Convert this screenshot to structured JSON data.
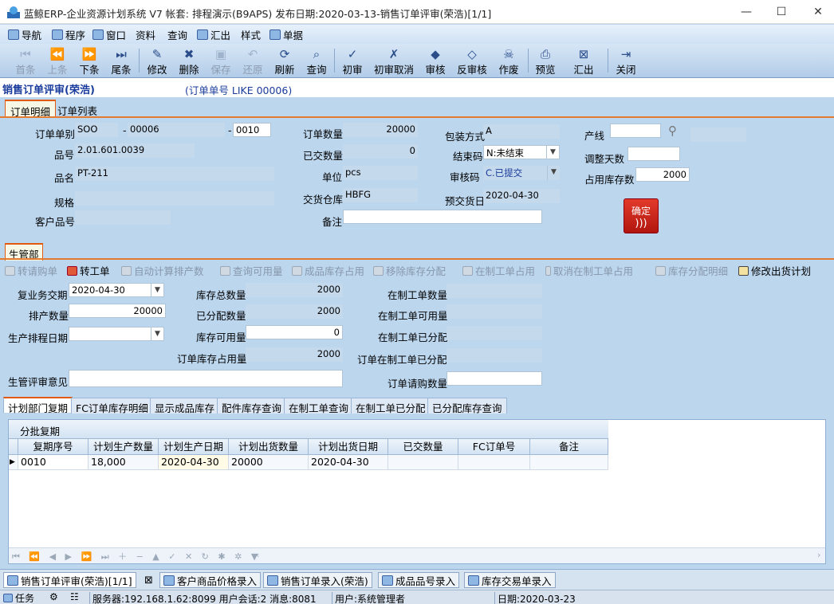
{
  "window": {
    "title": "蓝鲸ERP-企业资源计划系统 V7 帐套: 排程演示(B9APS) 发布日期:2020-03-13-销售订单评审(荣浩)[1/1]",
    "min": "—",
    "max": "☐",
    "close": "✕"
  },
  "menu": [
    "导航",
    "程序",
    "窗口",
    "资料",
    "查询",
    "汇出",
    "样式",
    "单据"
  ],
  "toolbar": [
    "首条",
    "上条",
    "下条",
    "尾条",
    "修改",
    "删除",
    "保存",
    "还原",
    "刷新",
    "查询",
    "初审",
    "初审取消",
    "审核",
    "反审核",
    "作废",
    "预览",
    "汇出",
    "关闭"
  ],
  "header": {
    "title": "销售订单评审(荣浩)",
    "filter": "(订单单号 LIKE 00006)"
  },
  "tabs": [
    "订单明细",
    "订单列表"
  ],
  "order": {
    "type_label": "订单单别",
    "type_value": "SOO",
    "no_value": "00006",
    "line_value": "0010",
    "item_label": "品号",
    "item_value": "2.01.601.0039",
    "name_label": "品名",
    "name_value": "PT-211",
    "spec_label": "规格",
    "spec_value": "",
    "cust_item_label": "客户品号",
    "cust_item_value": "",
    "qty_label": "订单数量",
    "qty_value": "20000",
    "delivered_label": "已交数量",
    "delivered_value": "0",
    "unit_label": "单位",
    "unit_value": "pcs",
    "warehouse_label": "交货仓库",
    "warehouse_value": "HBFG",
    "remark_label": "备注",
    "remark_value": "",
    "pack_label": "包装方式",
    "pack_value": "A",
    "close_label": "结束码",
    "close_value": "N:未结束",
    "audit_label": "审核码",
    "audit_value": "C.已提交",
    "eta_label": "预交货日",
    "eta_value": "2020-04-30",
    "line_label": "产线",
    "line_field": "",
    "adjust_label": "调整天数",
    "adjust_value": "",
    "stock_used_label": "占用库存数",
    "stock_used_value": "2000",
    "confirm": "确定"
  },
  "section_tab": "生管部",
  "tb2": [
    "转请购单",
    "转工单",
    "自动计算排产数",
    "查询可用量",
    "成品库存占用",
    "移除库存分配",
    "在制工单占用",
    "取消在制工单占用",
    "库存分配明细",
    "修改出货计划"
  ],
  "prod": {
    "reply_date_label": "复业务交期",
    "reply_date_value": "2020-04-30",
    "sched_qty_label": "排产数量",
    "sched_qty_value": "20000",
    "sched_date_label": "生产排程日期",
    "sched_date_value": "",
    "opinion_label": "生管评审意见",
    "opinion_value": "",
    "stock_total_label": "库存总数量",
    "stock_total_value": "2000",
    "allocated_label": "已分配数量",
    "allocated_value": "2000",
    "available_label": "库存可用量",
    "available_value": "0",
    "order_stock_label": "订单库存占用量",
    "order_stock_value": "2000",
    "wip_qty_label": "在制工单数量",
    "wip_qty_value": "",
    "wip_avail_label": "在制工单可用量",
    "wip_avail_value": "",
    "wip_alloc_label": "在制工单已分配",
    "wip_alloc_value": "",
    "order_wip_label": "订单在制工单已分配",
    "order_wip_value": "",
    "purchase_label": "订单请购数量",
    "purchase_value": ""
  },
  "subtabs": [
    "计划部门复期",
    "FC订单库存明细",
    "显示成品库存",
    "配件库存查询",
    "在制工单查询",
    "在制工单已分配",
    "已分配库存查询"
  ],
  "grid": {
    "group": "分批复期",
    "columns": [
      "复期序号",
      "计划生产数量",
      "计划生产日期",
      "计划出货数量",
      "计划出货日期",
      "已交数量",
      "FC订单号",
      "备注"
    ],
    "rows": [
      [
        "0010",
        "18,000",
        "2020-04-30",
        "20000",
        "2020-04-30",
        "",
        "",
        ""
      ]
    ]
  },
  "taskbar": [
    "销售订单评审(荣浩)[1/1]",
    "客户商品价格录入",
    "销售订单录入(荣浩)",
    "成品品号录入",
    "库存交易单录入"
  ],
  "status": {
    "task": "任务",
    "server": "服务器:192.168.1.62:8099 用户会话:2 消息:8081",
    "user": "用户:系统管理者",
    "date": "日期:2020-03-23"
  }
}
